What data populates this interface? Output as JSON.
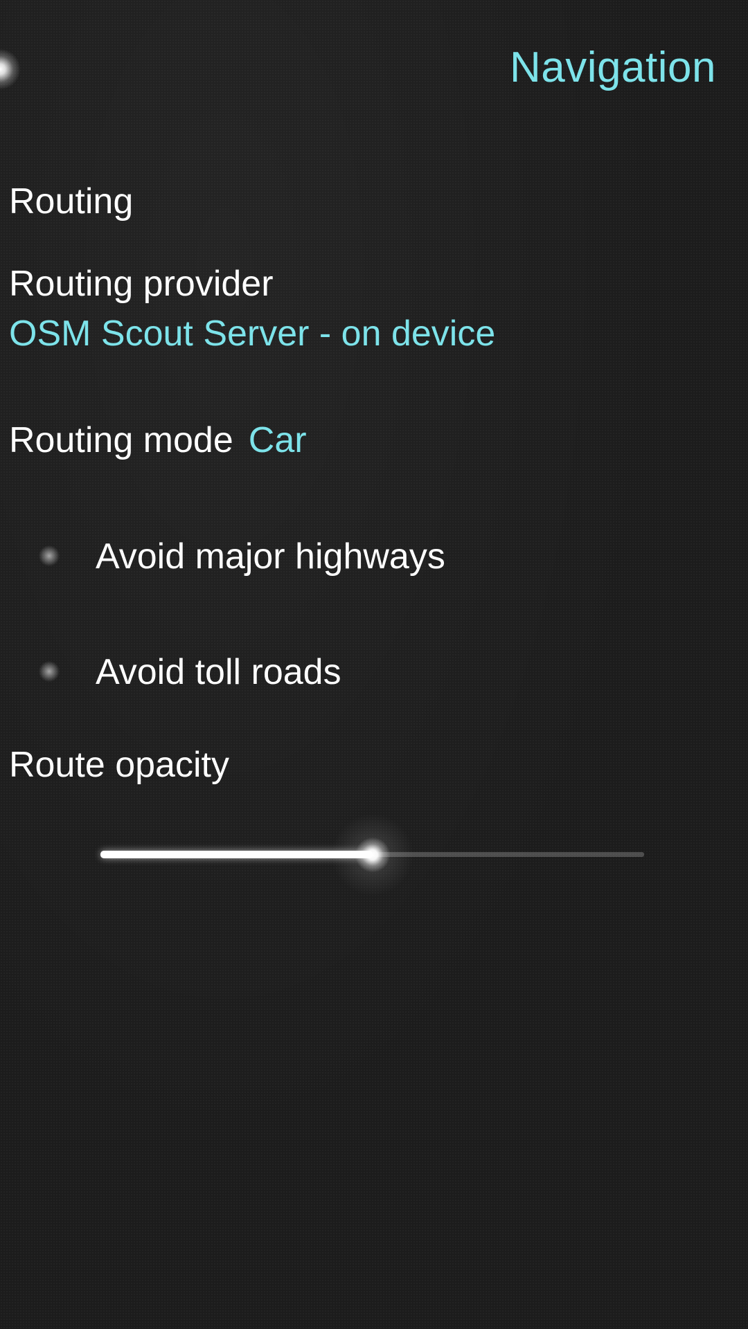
{
  "header": {
    "title": "Navigation"
  },
  "routing": {
    "section_title": "Routing",
    "provider_label": "Routing provider",
    "provider_value": "OSM Scout Server - on device",
    "mode_label": "Routing mode",
    "mode_value": "Car"
  },
  "switches": [
    {
      "label": "Avoid major highways",
      "checked": false
    },
    {
      "label": "Avoid toll roads",
      "checked": false
    }
  ],
  "opacity": {
    "label": "Route opacity",
    "value": 0.5
  },
  "colors": {
    "accent": "#7de3ea",
    "text": "#ffffff",
    "background": "#1c1c1c"
  }
}
